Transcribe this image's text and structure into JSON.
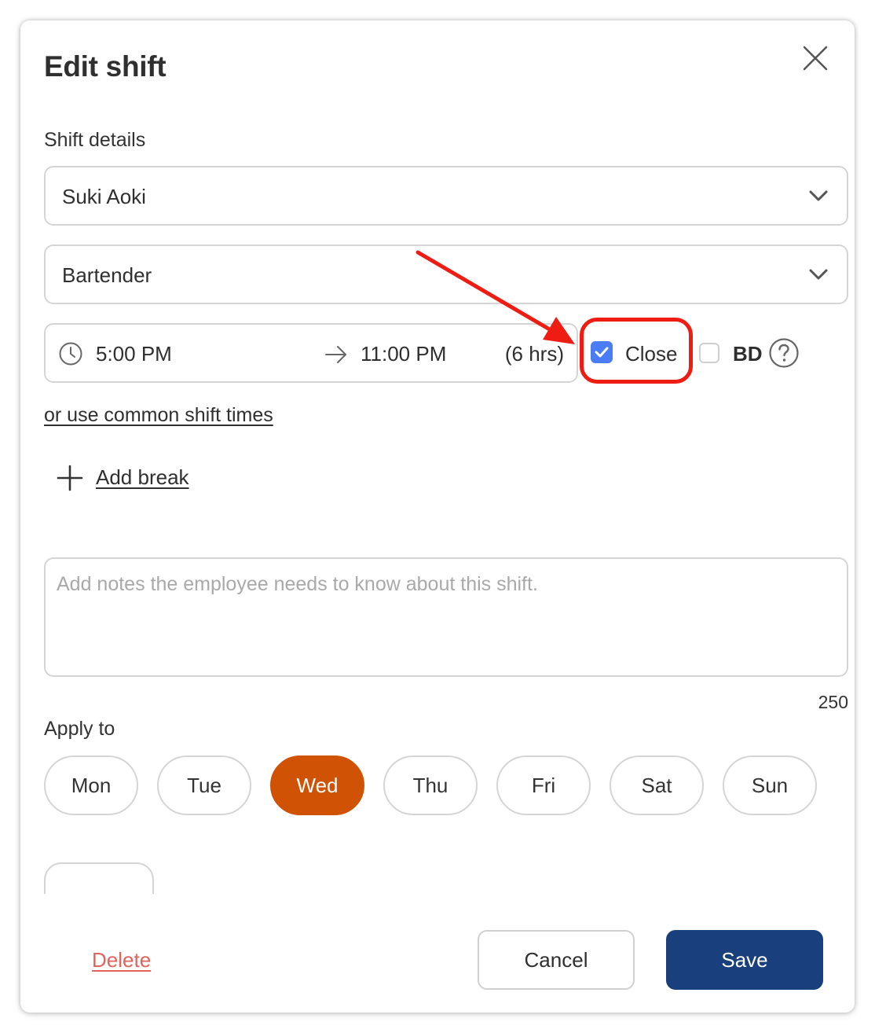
{
  "modal": {
    "title": "Edit shift",
    "close_icon": "close-x-icon"
  },
  "shift_details": {
    "label": "Shift details",
    "employee": "Suki Aoki",
    "role": "Bartender",
    "start_time": "5:00 PM",
    "end_time": "11:00 PM",
    "duration": "(6 hrs)",
    "close_checkbox": {
      "label": "Close",
      "checked": true
    },
    "bd_checkbox": {
      "label": "BD",
      "checked": false
    },
    "common_times_link": "or use common shift times",
    "add_break": "Add break"
  },
  "notes": {
    "placeholder": "Add notes the employee needs to know about this shift.",
    "value": "",
    "char_remaining": "250"
  },
  "apply_to": {
    "label": "Apply to",
    "days": [
      {
        "label": "Mon",
        "selected": false
      },
      {
        "label": "Tue",
        "selected": false
      },
      {
        "label": "Wed",
        "selected": true
      },
      {
        "label": "Thu",
        "selected": false
      },
      {
        "label": "Fri",
        "selected": false
      },
      {
        "label": "Sat",
        "selected": false
      },
      {
        "label": "Sun",
        "selected": false
      }
    ]
  },
  "footer": {
    "delete": "Delete",
    "cancel": "Cancel",
    "save": "Save"
  },
  "colors": {
    "accent_selected_day": "#cf5205",
    "primary_button": "#193f7c",
    "checkbox_checked": "#4a7df5",
    "delete_link": "#e0645d",
    "annotation": "#ee1c13"
  }
}
